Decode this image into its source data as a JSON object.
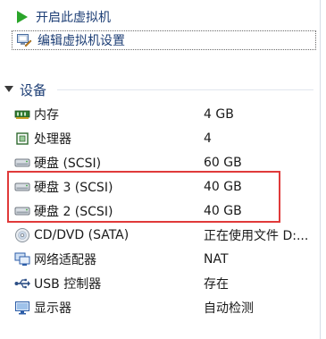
{
  "actions": {
    "start_vm": "开启此虚拟机",
    "edit_settings": "编辑虚拟机设置"
  },
  "devices_section": {
    "title": "设备"
  },
  "devices": [
    {
      "name": "内存",
      "value": "4 GB",
      "icon": "memory-icon"
    },
    {
      "name": "处理器",
      "value": "4",
      "icon": "cpu-icon"
    },
    {
      "name": "硬盘 (SCSI)",
      "value": "60 GB",
      "icon": "hard-disk-icon"
    },
    {
      "name": "硬盘 3 (SCSI)",
      "value": "40 GB",
      "icon": "hard-disk-icon"
    },
    {
      "name": "硬盘 2 (SCSI)",
      "value": "40 GB",
      "icon": "hard-disk-icon"
    },
    {
      "name": "CD/DVD (SATA)",
      "value": "正在使用文件 D:...",
      "icon": "cd-dvd-icon"
    },
    {
      "name": "网络适配器",
      "value": "NAT",
      "icon": "network-adapter-icon"
    },
    {
      "name": "USB 控制器",
      "value": "存在",
      "icon": "usb-icon"
    },
    {
      "name": "显示器",
      "value": "自动检测",
      "icon": "display-icon"
    }
  ],
  "colors": {
    "link_text": "#1e3f76",
    "highlight": "#e03a3a",
    "play_green": "#2aa52a"
  }
}
